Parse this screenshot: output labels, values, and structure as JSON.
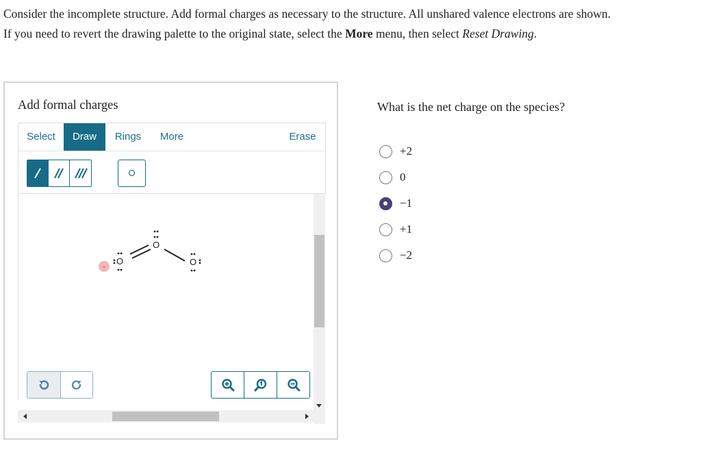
{
  "instructions": {
    "line1": "Consider the incomplete structure. Add formal charges as necessary to the structure. All unshared valence electrons are shown.",
    "line2_prefix": "If you need to revert the drawing palette to the original state, select the ",
    "line2_more": "More",
    "line2_mid": " menu, then select ",
    "line2_reset": "Reset Drawing",
    "line2_suffix": "."
  },
  "tool": {
    "title": "Add formal charges",
    "tabs": [
      "Select",
      "Draw",
      "Rings",
      "More"
    ],
    "active_tab": "Draw",
    "erase_label": "Erase",
    "atom_label": "O",
    "active_bond": "single-bond",
    "bond_types": [
      "single-bond",
      "double-bond",
      "triple-bond"
    ]
  },
  "molecule": {
    "atoms": [
      "O",
      "O",
      "O"
    ],
    "bonds": [
      "double",
      "single"
    ],
    "formal_charge_marker": "-"
  },
  "question": {
    "text": "What is the net charge on the species?",
    "options": [
      "+2",
      "0",
      "−1",
      "+1",
      "−2"
    ],
    "selected_index": 2
  },
  "colors": {
    "accent": "#176b87",
    "radio_selected": "#4a3f78",
    "charge_marker": "#f4b6b6"
  }
}
